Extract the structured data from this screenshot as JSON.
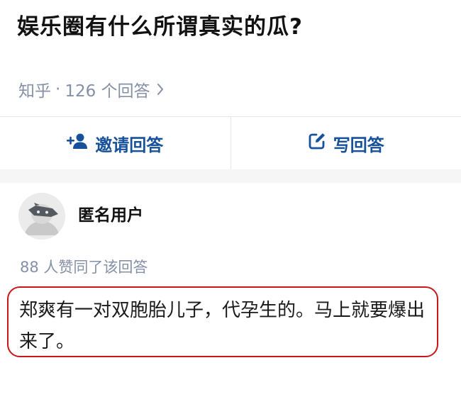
{
  "question": {
    "title": "娱乐圈有什么所谓真实的瓜?"
  },
  "meta": {
    "source": "知乎",
    "separator": "·",
    "answer_count": "126 个回答",
    "chevron_icon": "chevron-right-icon"
  },
  "actions": {
    "invite": {
      "label": "邀请回答",
      "icon": "add-person-icon"
    },
    "write": {
      "label": "写回答",
      "icon": "edit-icon"
    }
  },
  "answer": {
    "author": "匿名用户",
    "avatar_icon": "anonymous-avatar-icon",
    "votes": "88 人赞同了该回答",
    "text": "郑爽有一对双胞胎儿子，代孕生的。马上就要爆出来了。"
  },
  "colors": {
    "title": "#121212",
    "meta_gray": "#8590a6",
    "action_blue": "#175199",
    "highlight_red": "#c8171c"
  }
}
